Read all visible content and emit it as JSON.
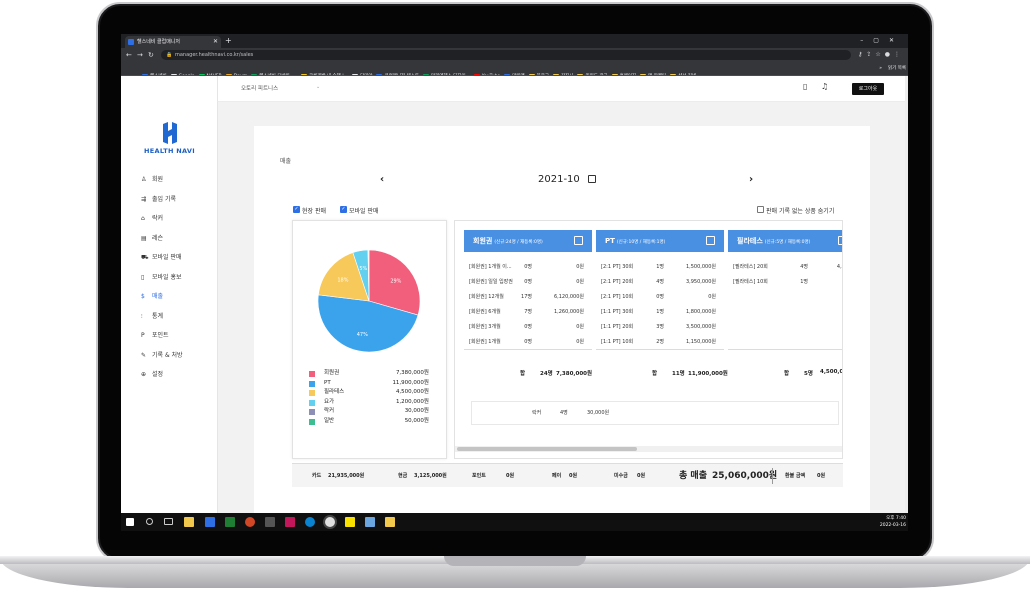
{
  "browser": {
    "tab_title": "헬스네비 클럽매니저",
    "url": "manager.healthnavi.co.kr/sales",
    "bookmarks": [
      {
        "label": "헬스네비",
        "color": "#2f6fe6"
      },
      {
        "label": "Google",
        "color": "#e8eaed"
      },
      {
        "label": "NAVER",
        "color": "#03c75a"
      },
      {
        "label": "Daum",
        "color": "#f2a81d"
      },
      {
        "label": "헬스네비 모바일 -...",
        "color": "#0f9d58"
      },
      {
        "label": "크롱개발 내 술책 |...",
        "color": "#f5c518"
      },
      {
        "label": "다미아",
        "color": "#e8eaed"
      },
      {
        "label": "클럽매니저 테스트",
        "color": "#2f6fe6"
      },
      {
        "label": "마리엔헤스 디자인...",
        "color": "#0f9d58"
      },
      {
        "label": "YouTube",
        "color": "#ff0000"
      },
      {
        "label": "마일앱",
        "color": "#2f6fe6"
      },
      {
        "label": "블로그",
        "color": "#f2c94c"
      },
      {
        "label": "갑짐사",
        "color": "#f2c94c"
      },
      {
        "label": "키워드 광고",
        "color": "#f2c94c"
      },
      {
        "label": "홈페이지",
        "color": "#f2c94c"
      },
      {
        "label": "앱 마케팅",
        "color": "#f2c94c"
      },
      {
        "label": "샵서 커넥",
        "color": "#f2c94c"
      }
    ],
    "bookmarks_more": "»",
    "reading_list": "읽기 목록"
  },
  "sidebar": {
    "logo_text": "HEALTH NAVI",
    "items": [
      {
        "label": "회원",
        "icon": "person-icon",
        "glyph": "♙"
      },
      {
        "label": "출입 기록",
        "icon": "entry-icon",
        "glyph": "⇶"
      },
      {
        "label": "락커",
        "icon": "locker-icon",
        "glyph": "⌂"
      },
      {
        "label": "레슨",
        "icon": "calendar-icon",
        "glyph": "▤"
      },
      {
        "label": "모바일 판매",
        "icon": "cart-icon",
        "glyph": "⛟"
      },
      {
        "label": "모바일 홍보",
        "icon": "phone-icon",
        "glyph": "▯"
      },
      {
        "label": "매출",
        "icon": "dollar-icon",
        "glyph": "$"
      },
      {
        "label": "통계",
        "icon": "stats-icon",
        "glyph": "⫶"
      },
      {
        "label": "포인트",
        "icon": "point-icon",
        "glyph": "P"
      },
      {
        "label": "기록 & 처방",
        "icon": "record-icon",
        "glyph": "✎"
      },
      {
        "label": "설정",
        "icon": "settings-icon",
        "glyph": "⊕"
      }
    ],
    "active_index": 6
  },
  "topbar": {
    "center_select": "오토리 피트니스",
    "logout_label": "로그아웃"
  },
  "page": {
    "title": "매출",
    "month": "2021-10",
    "prev": "‹",
    "next": "›",
    "check_onsite": "현장 판매",
    "check_mobile": "모바일 판매",
    "check_hide_empty": "판매 기록 없는 상품 숨기기"
  },
  "chart_data": {
    "type": "pie",
    "categories": [
      "회원권",
      "PT",
      "필라테스",
      "요가",
      "락커",
      "일반"
    ],
    "values": [
      7380000,
      11900000,
      4500000,
      1200000,
      30000,
      50000
    ],
    "value_labels": [
      "7,380,000원",
      "11,900,000원",
      "4,500,000원",
      "1,200,000원",
      "30,000원",
      "50,000원"
    ],
    "percent_labels": [
      "29%",
      "47%",
      "18%",
      "5%",
      "",
      ""
    ],
    "colors": [
      "#f25f7c",
      "#3ba3ec",
      "#f7c85a",
      "#62d0ee",
      "#8e8fb6",
      "#3dbe92"
    ]
  },
  "products": [
    {
      "title": "회원권",
      "sub": "(신규:24명 / 재등록:0명)",
      "rows": [
        [
          "[회원권] 1개월 이...",
          "0명",
          "0원"
        ],
        [
          "[회원권] 일일 입장권",
          "0명",
          "0원"
        ],
        [
          "[회원권] 12개월",
          "17명",
          "6,120,000원"
        ],
        [
          "[회원권] 6개월",
          "7명",
          "1,260,000원"
        ],
        [
          "[회원권] 3개월",
          "0명",
          "0원"
        ],
        [
          "[회원권] 1개월",
          "0명",
          "0원"
        ]
      ],
      "sum_label": "합",
      "sum_count": "24명",
      "sum_value": "7,380,000원"
    },
    {
      "title": "PT",
      "sub": "(신규:10명 / 재등록:1명)",
      "rows": [
        [
          "[2:1 PT] 30회",
          "1명",
          "1,500,000원"
        ],
        [
          "[2:1 PT] 20회",
          "4명",
          "3,950,000원"
        ],
        [
          "[2:1 PT] 10회",
          "0명",
          "0원"
        ],
        [
          "[1:1 PT] 30회",
          "1명",
          "1,800,000원"
        ],
        [
          "[1:1 PT] 20회",
          "3명",
          "3,500,000원"
        ],
        [
          "[1:1 PT] 10회",
          "2명",
          "1,150,000원"
        ]
      ],
      "sum_label": "합",
      "sum_count": "11명",
      "sum_value": "11,900,000원"
    },
    {
      "title": "필라테스",
      "sub": "(신규:5명 / 재등록:0명)",
      "rows": [
        [
          "[필라테스] 20회",
          "4명",
          "4,000,0"
        ],
        [
          "[필라테스] 10회",
          "1명",
          "500,0"
        ]
      ],
      "sum_label": "합",
      "sum_count": "5명",
      "sum_value": "4,500,000"
    }
  ],
  "locker": {
    "label": "락커",
    "count": "4명",
    "value": "30,000원"
  },
  "totals": {
    "card_label": "카드",
    "card": "21,935,000원",
    "cash_label": "현금",
    "cash": "3,125,000원",
    "point_label": "포인트",
    "point": "0원",
    "pay_label": "페이",
    "pay": "0원",
    "unpaid_label": "미수금",
    "unpaid": "0원",
    "total_label": "총 매출",
    "total": "25,060,000원",
    "refund_label": "환불 금액",
    "refund": "0원"
  },
  "taskbar": {
    "time": "오후 7:40",
    "date": "2022-03-16"
  }
}
